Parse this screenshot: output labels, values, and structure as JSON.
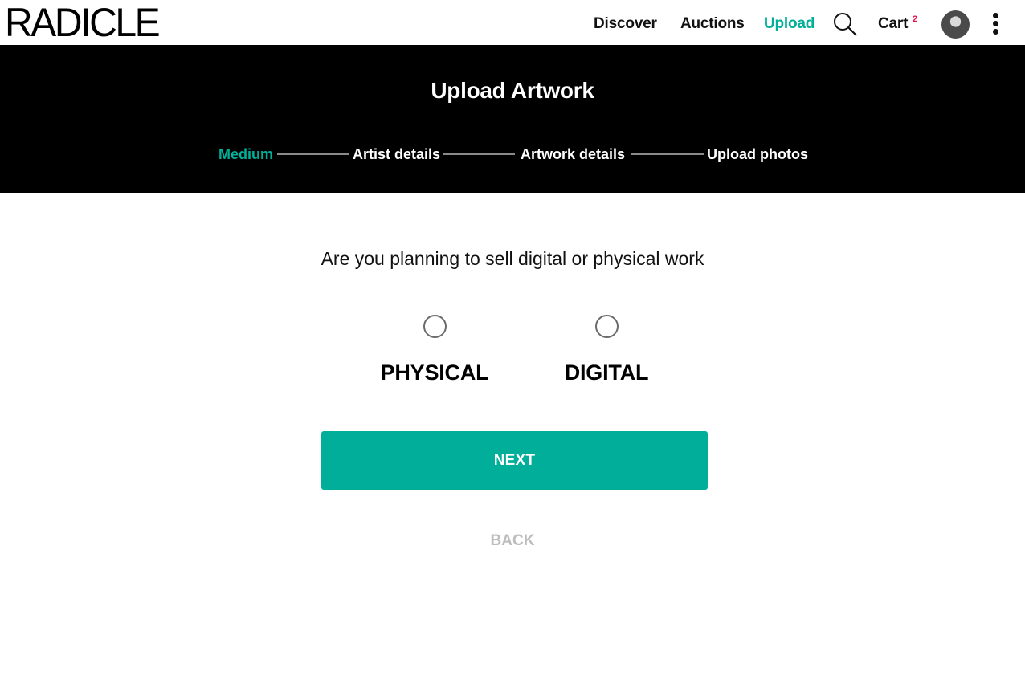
{
  "header": {
    "logo": "RADICLE",
    "nav": [
      {
        "label": "Discover"
      },
      {
        "label": "Auctions"
      },
      {
        "label": "Upload",
        "active": true
      }
    ],
    "search_icon": "search-icon",
    "cart_label": "Cart",
    "cart_count": "2",
    "avatar_icon": "user-avatar",
    "menu_icon": "kebab-menu-icon"
  },
  "hero": {
    "title": "Upload Artwork",
    "steps": [
      {
        "label": "Medium",
        "active": true
      },
      {
        "label": "Artist details"
      },
      {
        "label": "Artwork details"
      },
      {
        "label": "Upload photos"
      }
    ]
  },
  "form": {
    "question": "Are you planning to sell digital or physical work",
    "options": [
      {
        "label": "PHYSICAL",
        "selected": false
      },
      {
        "label": "DIGITAL",
        "selected": false
      }
    ],
    "next_label": "NEXT",
    "back_label": "BACK"
  },
  "colors": {
    "accent": "#00ae99",
    "badge": "#e3134b",
    "hero_bg": "#000000",
    "muted": "#bdbdbd"
  }
}
